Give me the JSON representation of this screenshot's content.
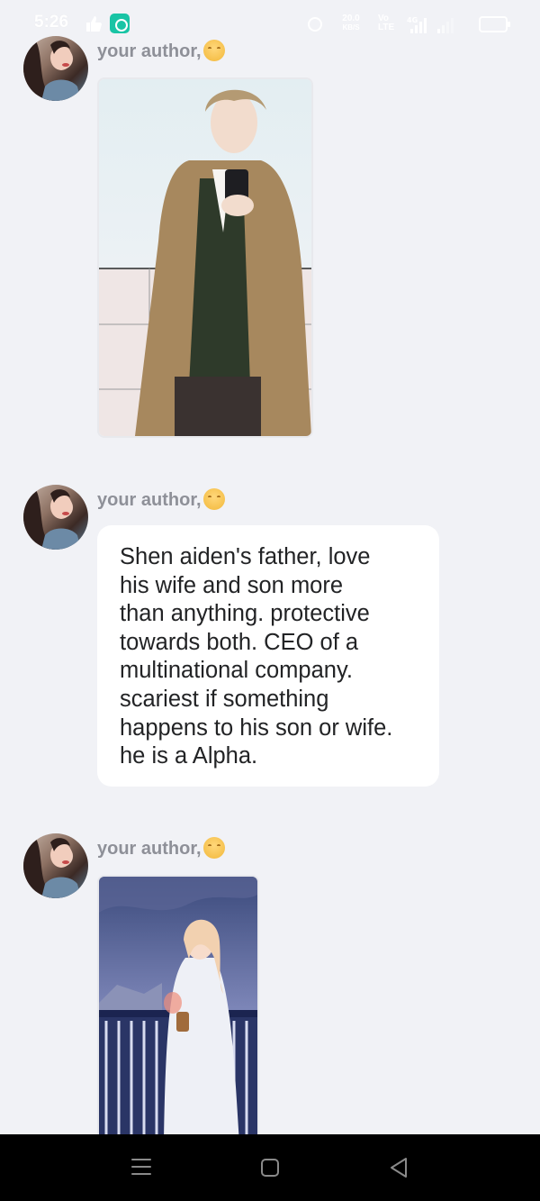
{
  "status_bar": {
    "time": "5:26",
    "speed_value": "20.0",
    "speed_unit": "KB/S",
    "network_label": "Vo LTE",
    "network_gen": "4G"
  },
  "messages": [
    {
      "author": "your author,",
      "kind": "image",
      "image_desc": "character-illustration"
    },
    {
      "author": "your author,",
      "kind": "text",
      "text": "Shen aiden's father, love\nhis wife and son more\nthan anything. protective\ntowards both. CEO of a\nmultinational company.\nscariest if something\nhappens to his son or wife.\nhe is a Alpha."
    },
    {
      "author": "your author,",
      "kind": "image",
      "image_desc": "character-illustration"
    }
  ],
  "colors": {
    "background": "#f1f2f6",
    "bubble": "#ffffff",
    "author_text": "#8e9098",
    "accent_app": "#19c4a5",
    "nav_bar": "#000000"
  },
  "icons": {
    "author_emoji": "hugging-face-icon",
    "nav": [
      "menu-icon",
      "home-icon",
      "back-icon"
    ]
  }
}
